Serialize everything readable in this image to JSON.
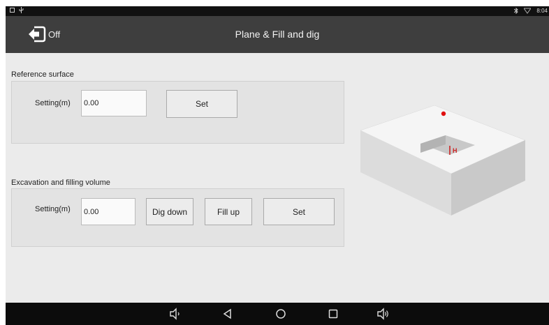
{
  "status_bar": {
    "time": "8:04"
  },
  "app_bar": {
    "back_label": "Off",
    "title": "Plane & Fill and dig"
  },
  "reference_surface": {
    "title": "Reference surface",
    "setting_label": "Setting(m)",
    "setting_value": "0.00",
    "set_label": "Set"
  },
  "excavation": {
    "title": "Excavation and filling volume",
    "setting_label": "Setting(m)",
    "setting_value": "0.00",
    "dig_down_label": "Dig down",
    "fill_up_label": "Fill up",
    "set_label": "Set"
  },
  "illustration": {
    "height_marker": "H",
    "point_color": "#e01010",
    "marker_color": "#cc2222"
  },
  "nav_bar": {
    "icons": [
      "volume-down-icon",
      "back-icon",
      "home-icon",
      "recents-icon",
      "volume-up-icon"
    ]
  },
  "colors": {
    "app_bar": "#3e3e3e",
    "content_bg": "#ebebeb",
    "nav_bar": "#0c0c0c"
  }
}
